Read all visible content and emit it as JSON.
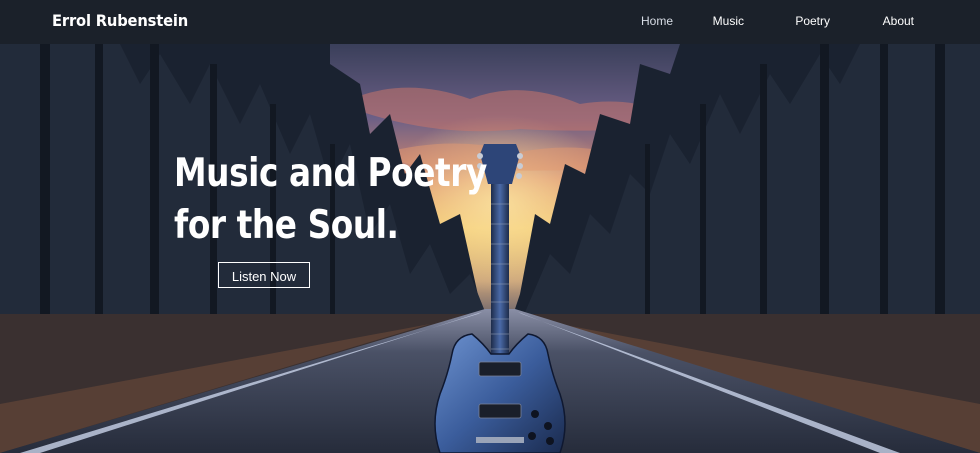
{
  "header": {
    "site_title": "Errol Rubenstein",
    "nav": [
      {
        "label": "Home",
        "active": true
      },
      {
        "label": "Music",
        "active": false
      },
      {
        "label": "Poetry",
        "active": false
      },
      {
        "label": "About",
        "active": false
      }
    ]
  },
  "hero": {
    "headline_line1": "Music and Poetry",
    "headline_line2": "for the Soul.",
    "cta_label": "Listen Now",
    "background_image": "guitar standing on a forest road at sunset"
  },
  "colors": {
    "header_bg": "#1b212a",
    "text": "#ffffff",
    "sky_glow": "#f2c66a",
    "sky_dusk": "#6b5f86",
    "road": "#2e3547",
    "guitar_blue": "#3b5d9c"
  }
}
